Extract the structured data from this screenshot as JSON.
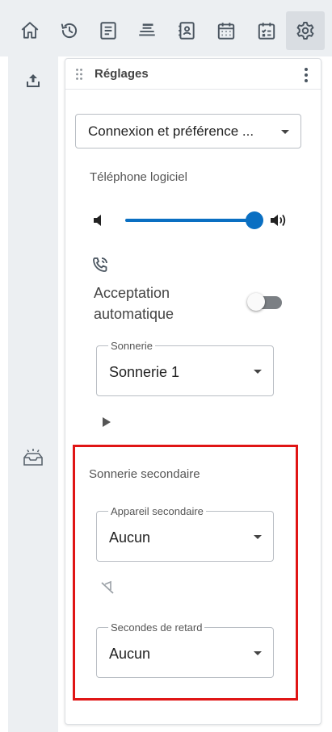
{
  "toolbar": {
    "icons": [
      "home-icon",
      "history-icon",
      "notes-icon",
      "queue-icon",
      "contacts-icon",
      "calendar-icon",
      "tasks-icon",
      "gear-icon"
    ],
    "active": "gear-icon",
    "active_bg": "#d9dde2"
  },
  "left_strip": {
    "icons": [
      "upload-icon",
      "inbox-icon"
    ]
  },
  "panel": {
    "title": "Réglages",
    "category_select": {
      "value": "Connexion et préférence ..."
    },
    "softphone": {
      "label": "Téléphone logiciel",
      "volume_percent": 100,
      "auto_answer_label": "Acceptation automatique",
      "auto_answer_on": false,
      "ringtone": {
        "legend": "Sonnerie",
        "value": "Sonnerie 1"
      }
    },
    "secondary_ring": {
      "label": "Sonnerie secondaire",
      "device": {
        "legend": "Appareil secondaire",
        "value": "Aucun"
      },
      "delay": {
        "legend": "Secondes de retard",
        "value": "Aucun"
      }
    }
  },
  "colors": {
    "accent": "#0a6fc2",
    "highlight_border": "#e01515",
    "toolbar_bg": "#eceff2"
  }
}
